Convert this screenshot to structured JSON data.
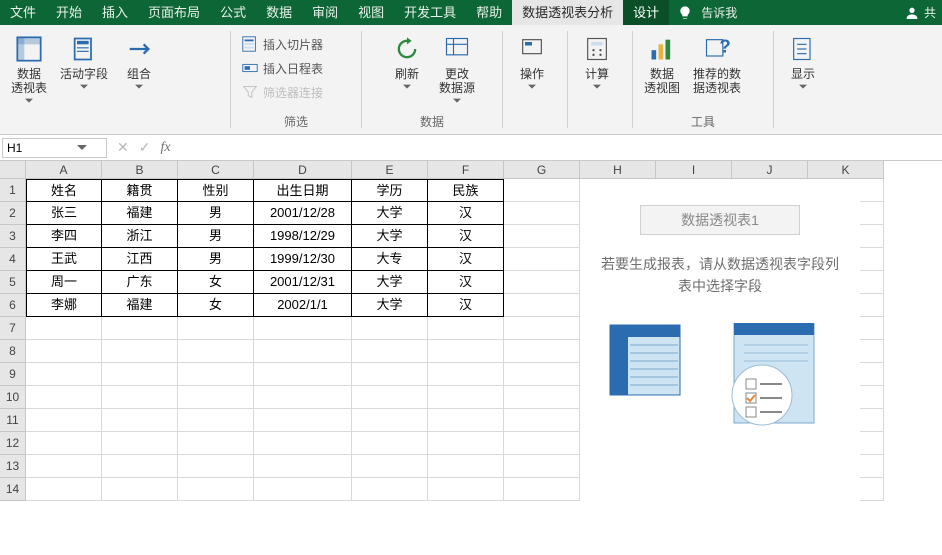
{
  "tabs": [
    "文件",
    "开始",
    "插入",
    "页面布局",
    "公式",
    "数据",
    "审阅",
    "视图",
    "开发工具",
    "帮助",
    "数据透视表分析",
    "设计"
  ],
  "tabs_active_index": 10,
  "tellme": "告诉我",
  "share": "共",
  "ribbon": {
    "g1": {
      "pivot": "数据\n透视表",
      "active": "活动字段",
      "group": "组合"
    },
    "filter": {
      "slicer": "插入切片器",
      "timeline": "插入日程表",
      "connect": "筛选器连接",
      "title": "筛选"
    },
    "data": {
      "refresh": "刷新",
      "change": "更改\n数据源",
      "title": "数据"
    },
    "actions": {
      "btn": "操作"
    },
    "calc": {
      "btn": "计算"
    },
    "tools": {
      "chart": "数据\n透视图",
      "recommend": "推荐的数\n据透视表",
      "title": "工具"
    },
    "show": {
      "btn": "显示"
    }
  },
  "namebox": "H1",
  "columns": [
    "A",
    "B",
    "C",
    "D",
    "E",
    "F",
    "G",
    "H",
    "I",
    "J",
    "K"
  ],
  "row_numbers": [
    "1",
    "2",
    "3",
    "4",
    "5",
    "6",
    "7",
    "8",
    "9",
    "10",
    "11",
    "12",
    "13",
    "14"
  ],
  "table": {
    "headers": [
      "姓名",
      "籍贯",
      "性别",
      "出生日期",
      "学历",
      "民族"
    ],
    "rows": [
      [
        "张三",
        "福建",
        "男",
        "2001/12/28",
        "大学",
        "汉"
      ],
      [
        "李四",
        "浙江",
        "男",
        "1998/12/29",
        "大学",
        "汉"
      ],
      [
        "王武",
        "江西",
        "男",
        "1999/12/30",
        "大专",
        "汉"
      ],
      [
        "周一",
        "广东",
        "女",
        "2001/12/31",
        "大学",
        "汉"
      ],
      [
        "李娜",
        "福建",
        "女",
        "2002/1/1",
        "大学",
        "汉"
      ]
    ]
  },
  "pivot_placeholder": {
    "title": "数据透视表1",
    "message": "若要生成报表，请从数据透视表字段列表中选择字段"
  }
}
